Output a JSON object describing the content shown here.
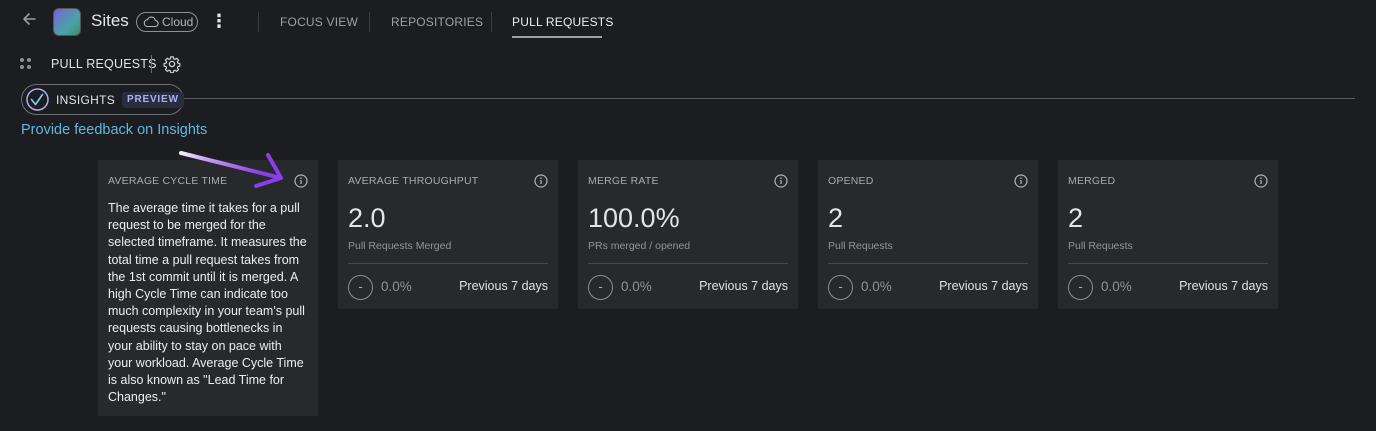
{
  "nav": {
    "app_name": "Sites",
    "cloud_label": "Cloud",
    "tabs": [
      {
        "label": "FOCUS VIEW"
      },
      {
        "label": "REPOSITORIES"
      },
      {
        "label": "PULL REQUESTS",
        "active": true
      }
    ]
  },
  "subheader": {
    "title": "PULL REQUESTS"
  },
  "insights": {
    "label": "INSIGHTS",
    "badge": "PREVIEW",
    "feedback_link": "Provide feedback on Insights"
  },
  "cards": [
    {
      "title": "AVERAGE CYCLE TIME",
      "tooltip": "The average time it takes for a pull request to be merged for the selected timeframe. It measures the total time a pull request takes from the 1st commit until it is merged. A high Cycle Time can indicate too much complexity in your team's pull requests causing bottlenecks in your ability to stay on pace with your workload. Average Cycle Time is also known as \"Lead Time for Changes.\""
    },
    {
      "title": "AVERAGE THROUGHPUT",
      "value": "2.0",
      "subtitle": "Pull Requests Merged",
      "trend_symbol": "-",
      "trend": "0.0%",
      "period": "Previous 7 days"
    },
    {
      "title": "MERGE RATE",
      "value": "100.0%",
      "subtitle": "PRs merged / opened",
      "trend_symbol": "-",
      "trend": "0.0%",
      "period": "Previous 7 days"
    },
    {
      "title": "OPENED",
      "value": "2",
      "subtitle": "Pull Requests",
      "trend_symbol": "-",
      "trend": "0.0%",
      "period": "Previous 7 days"
    },
    {
      "title": "MERGED",
      "value": "2",
      "subtitle": "Pull Requests",
      "trend_symbol": "-",
      "trend": "0.0%",
      "period": "Previous 7 days"
    }
  ],
  "colors": {
    "background": "#1c1d20",
    "card": "#28292d",
    "link": "#5fb7e3",
    "annotation_arrow": "#8b3fe6"
  }
}
